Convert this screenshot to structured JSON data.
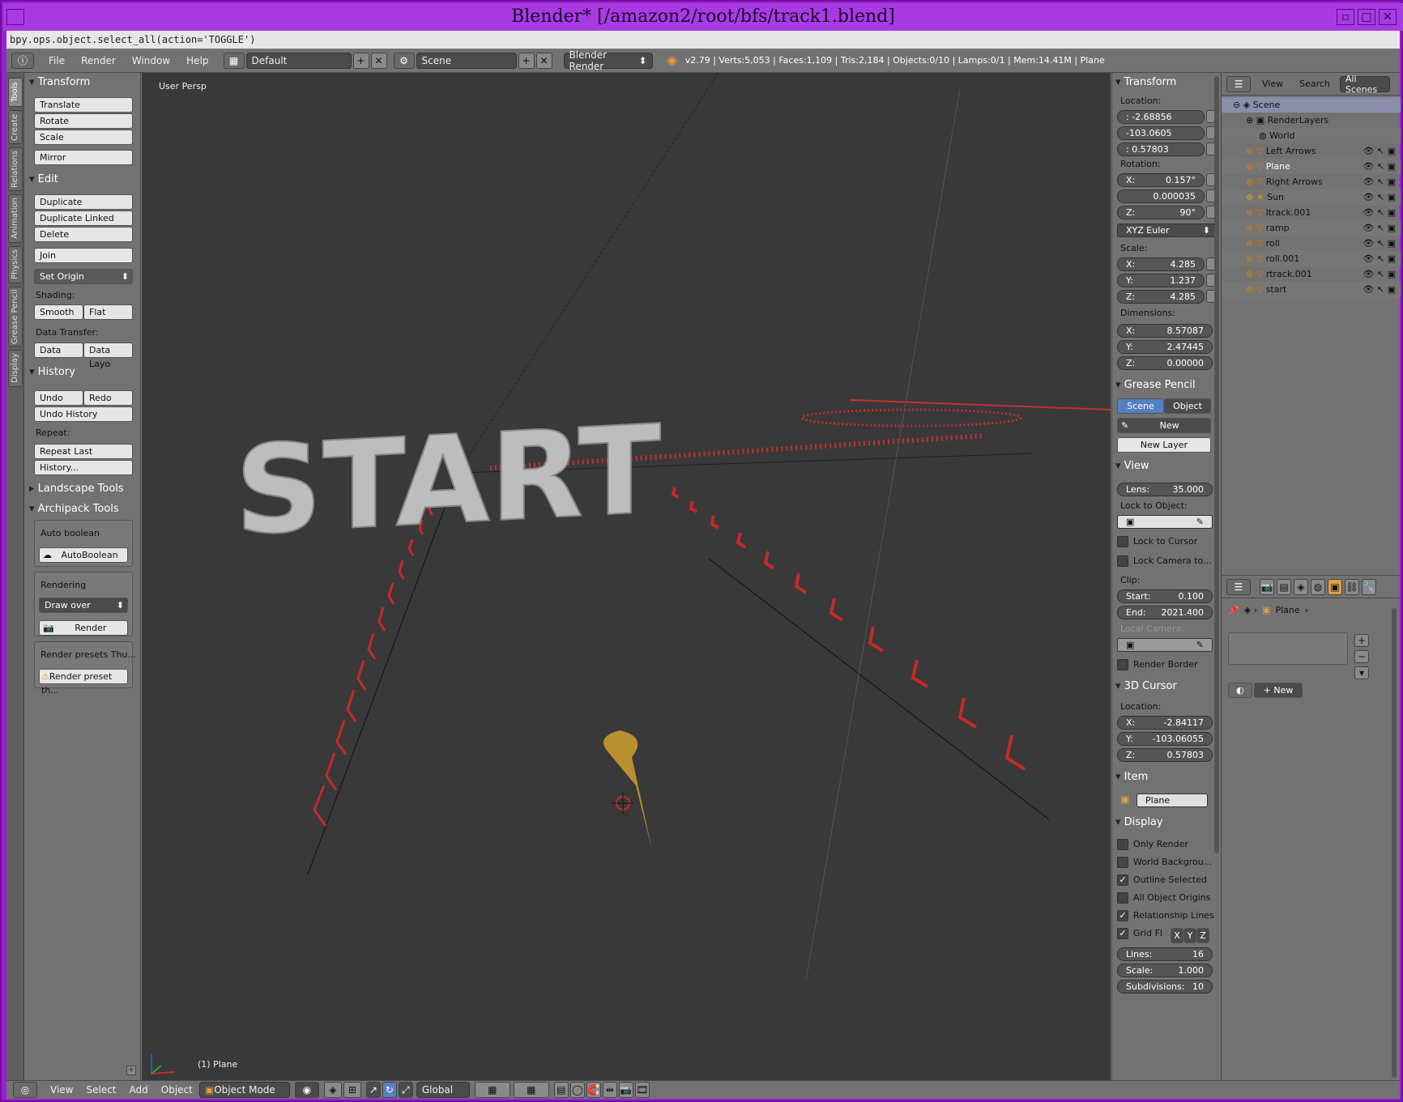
{
  "window": {
    "title": "Blender* [/amazon2/root/bfs/track1.blend]"
  },
  "info": {
    "last_op": "bpy.ops.object.select_all(action='TOGGLE')"
  },
  "menu": {
    "file": "File",
    "render": "Render",
    "window": "Window",
    "help": "Help"
  },
  "screen": {
    "layout": "Default",
    "scene": "Scene",
    "engine": "Blender Render"
  },
  "stats": "v2.79 | Verts:5,053 | Faces:1,109 | Tris:2,184 | Objects:0/10 | Lamps:0/1 | Mem:14.41M | Plane",
  "tool_tabs": [
    "Tools",
    "Create",
    "Relations",
    "Animation",
    "Physics",
    "Grease Pencil",
    "Display"
  ],
  "tools": {
    "transform_title": "Transform",
    "translate": "Translate",
    "rotate": "Rotate",
    "scale": "Scale",
    "mirror": "Mirror",
    "edit_title": "Edit",
    "duplicate": "Duplicate",
    "duplicate_linked": "Duplicate Linked",
    "delete": "Delete",
    "join": "Join",
    "set_origin": "Set Origin",
    "shading_label": "Shading:",
    "smooth": "Smooth",
    "flat": "Flat",
    "data_transfer_label": "Data Transfer:",
    "data": "Data",
    "data_layout": "Data Layo",
    "history_title": "History",
    "undo": "Undo",
    "redo": "Redo",
    "undo_history": "Undo History",
    "repeat_label": "Repeat:",
    "repeat_last": "Repeat Last",
    "history_btn": "History...",
    "landscape_title": "Landscape Tools",
    "archipack_title": "Archipack Tools",
    "auto_boolean_label": "Auto boolean",
    "auto_boolean_btn": "AutoBoolean",
    "rendering_label": "Rendering",
    "draw_over": "Draw over",
    "render_btn": "Render",
    "render_presets_label": "Render presets Thu...",
    "render_preset_btn": "Render preset th..."
  },
  "viewport": {
    "view_name": "User Persp",
    "selected": "(1) Plane",
    "scene_text": "START"
  },
  "npanel": {
    "transform_title": "Transform",
    "location_label": "Location:",
    "loc": [
      ": -2.68856",
      "-103.0605",
      ": 0.57803"
    ],
    "rotation_label": "Rotation:",
    "rot": [
      [
        "X:",
        "0.157°"
      ],
      [
        "",
        "0.000035"
      ],
      [
        "Z:",
        "90°"
      ]
    ],
    "rot_mode": "XYZ Euler",
    "scale_label": "Scale:",
    "scale": [
      [
        "X:",
        "4.285"
      ],
      [
        "Y:",
        "1.237"
      ],
      [
        "Z:",
        "4.285"
      ]
    ],
    "dim_label": "Dimensions:",
    "dim": [
      [
        "X:",
        "8.57087"
      ],
      [
        "Y:",
        "2.47445"
      ],
      [
        "Z:",
        "0.00000"
      ]
    ],
    "gp_title": "Grease Pencil",
    "gp_scene": "Scene",
    "gp_object": "Object",
    "gp_new": "New",
    "gp_new_layer": "New Layer",
    "view_title": "View",
    "lens_label": "Lens:",
    "lens": "35.000",
    "lock_obj_label": "Lock to Object:",
    "lock_cursor": "Lock to Cursor",
    "lock_camera": "Lock Camera to...",
    "clip_label": "Clip:",
    "clip_start_label": "Start:",
    "clip_start": "0.100",
    "clip_end_label": "End:",
    "clip_end": "2021.400",
    "local_camera": "Local Camera:",
    "render_border": "Render Border",
    "cursor_title": "3D Cursor",
    "cursor_loc_label": "Location:",
    "cursor": [
      [
        "X:",
        "-2.84117"
      ],
      [
        "Y:",
        "-103.06055"
      ],
      [
        "Z:",
        "0.57803"
      ]
    ],
    "item_title": "Item",
    "item_name": "Plane",
    "display_title": "Display",
    "only_render": "Only Render",
    "world_bg": "World Backgrou...",
    "outline_sel": "Outline Selected",
    "all_origins": "All Object Origins",
    "rel_lines": "Relationship Lines",
    "grid_fl": "Grid Fl",
    "axis_x": "X",
    "axis_y": "Y",
    "axis_z": "Z",
    "lines_label": "Lines:",
    "lines": "16",
    "gscale_label": "Scale:",
    "gscale": "1.000",
    "subdiv_label": "Subdivisions:",
    "subdiv": "10"
  },
  "outliner": {
    "view": "View",
    "search": "Search",
    "filter": "All Scenes",
    "items": [
      "Scene",
      "RenderLayers",
      "World",
      "Left Arrows",
      "Plane",
      "Right Arrows",
      "Sun",
      "ltrack.001",
      "ramp",
      "roll",
      "roll.001",
      "rtrack.001",
      "start"
    ]
  },
  "props": {
    "object_name": "Plane",
    "new": "New"
  },
  "footer": {
    "view": "View",
    "select": "Select",
    "add": "Add",
    "object": "Object",
    "mode": "Object Mode",
    "orientation": "Global"
  }
}
